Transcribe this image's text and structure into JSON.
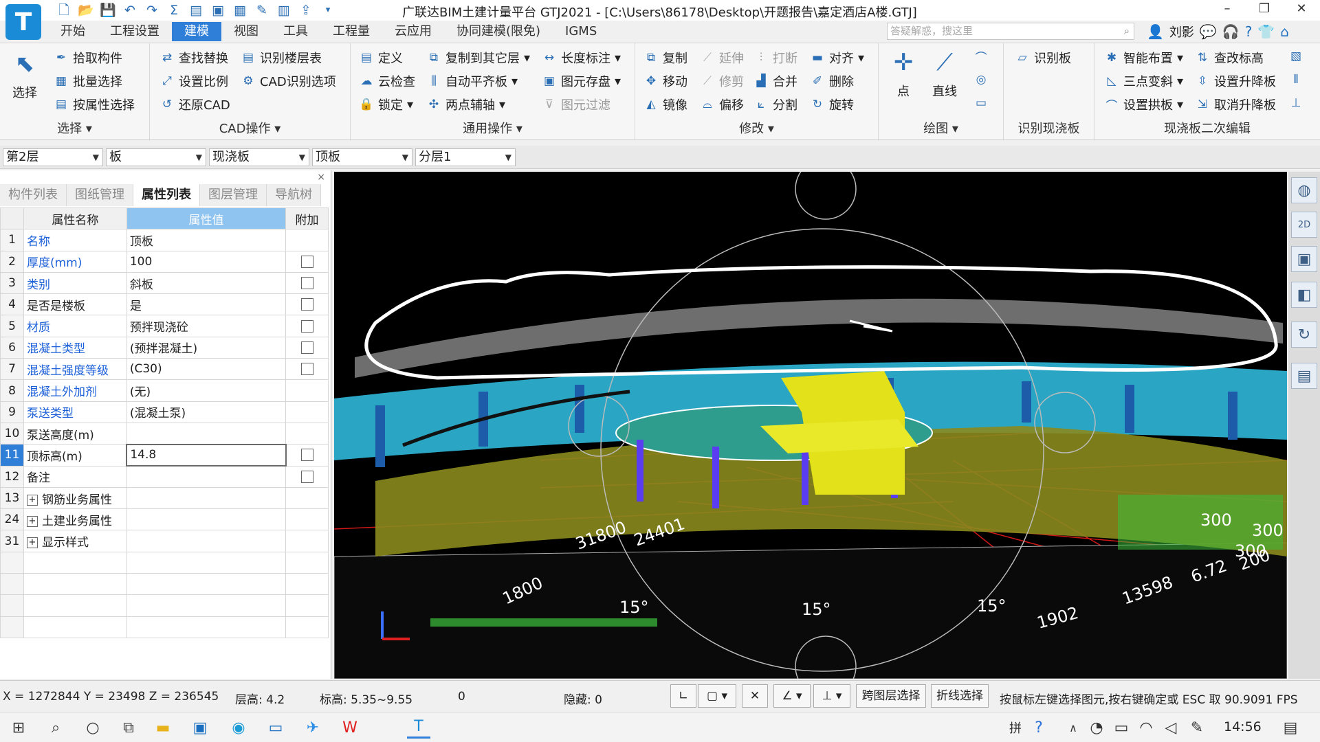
{
  "window": {
    "title": "广联达BIM土建计量平台 GTJ2021 - [C:\\Users\\86178\\Desktop\\开题报告\\嘉定酒店A楼.GTJ]",
    "app_logo": "T",
    "minimize": "–",
    "restore": "❐",
    "close": "✕"
  },
  "ribbon_tabs": [
    "开始",
    "工程设置",
    "建模",
    "视图",
    "工具",
    "工程量",
    "云应用",
    "协同建模(限免)",
    "IGMS"
  ],
  "search": {
    "placeholder": "答疑解惑，搜这里"
  },
  "user": {
    "name": "刘影"
  },
  "ribbon": {
    "select": {
      "big": "选择",
      "items": [
        "拾取构件",
        "批量选择",
        "按属性选择"
      ],
      "title": "选择"
    },
    "cad": {
      "items": [
        "查找替换",
        "识别楼层表",
        "设置比例",
        "CAD识别选项",
        "还原CAD"
      ],
      "title": "CAD操作"
    },
    "common": {
      "items": [
        "定义",
        "复制到其它层",
        "长度标注",
        "云检查",
        "自动平齐板",
        "图元存盘",
        "锁定",
        "两点辅轴",
        "图元过滤"
      ],
      "title": "通用操作"
    },
    "modify": {
      "items": [
        "复制",
        "延伸",
        "打断",
        "对齐",
        "移动",
        "修剪",
        "合并",
        "删除",
        "镜像",
        "偏移",
        "分割",
        "旋转"
      ],
      "title": "修改"
    },
    "draw": {
      "items": [
        "点",
        "直线"
      ],
      "title": "绘图"
    },
    "recognize": {
      "items": [
        "识别板"
      ],
      "title": "识别现浇板"
    },
    "slab_edit": {
      "items": [
        "智能布置",
        "查改标高",
        "三点变斜",
        "设置升降板",
        "设置拱板",
        "取消升降板"
      ],
      "title": "现浇板二次编辑"
    }
  },
  "dropdowns": [
    "第2层",
    "板",
    "现浇板",
    "顶板",
    "分层1"
  ],
  "panel": {
    "tabs": [
      "构件列表",
      "图纸管理",
      "属性列表",
      "图层管理",
      "导航树"
    ],
    "active_tab": "属性列表",
    "close": "×",
    "headers": {
      "name": "属性名称",
      "value": "属性值",
      "extra": "附加"
    },
    "rows": [
      {
        "num": "1",
        "name": "名称",
        "value": "顶板",
        "check": false
      },
      {
        "num": "2",
        "name": "厚度(mm)",
        "value": "100",
        "check": true
      },
      {
        "num": "3",
        "name": "类别",
        "value": "斜板",
        "check": true
      },
      {
        "num": "4",
        "name": "是否是楼板",
        "value": "是",
        "check": true
      },
      {
        "num": "5",
        "name": "材质",
        "value": "预拌现浇砼",
        "check": true
      },
      {
        "num": "6",
        "name": "混凝土类型",
        "value": "(预拌混凝土)",
        "check": true
      },
      {
        "num": "7",
        "name": "混凝土强度等级",
        "value": "(C30)",
        "check": true
      },
      {
        "num": "8",
        "name": "混凝土外加剂",
        "value": "(无)",
        "check": false
      },
      {
        "num": "9",
        "name": "泵送类型",
        "value": "(混凝土泵)",
        "check": false
      },
      {
        "num": "10",
        "name": "泵送高度(m)",
        "value": "",
        "check": false
      },
      {
        "num": "11",
        "name": "顶标高(m)",
        "value": "14.8",
        "check": true
      },
      {
        "num": "12",
        "name": "备注",
        "value": "",
        "check": true
      },
      {
        "num": "13",
        "name": "钢筋业务属性",
        "value": "",
        "check": false
      },
      {
        "num": "24",
        "name": "土建业务属性",
        "value": "",
        "check": false
      },
      {
        "num": "31",
        "name": "显示样式",
        "value": "",
        "check": false
      }
    ]
  },
  "viewport_labels": [
    "31800",
    "24401",
    "1800",
    "15°",
    "15°",
    "15°",
    "1902",
    "13598",
    "300",
    "300",
    "300",
    "6.72",
    "200"
  ],
  "status": {
    "coords": "X = 1272844 Y = 23498 Z = 236545",
    "floor_height": "层高:  4.2",
    "elevation": "标高:  5.35~9.55",
    "zero": "0",
    "hidden": "隐藏:  0",
    "btn_cross": "跨图层选择",
    "btn_poly": "折线选择",
    "hint": "按鼠标左键选择图元,按右键确定或 ESC 取 90.9091 FPS"
  },
  "taskbar": {
    "time": "14:56",
    "ime": "拼"
  }
}
